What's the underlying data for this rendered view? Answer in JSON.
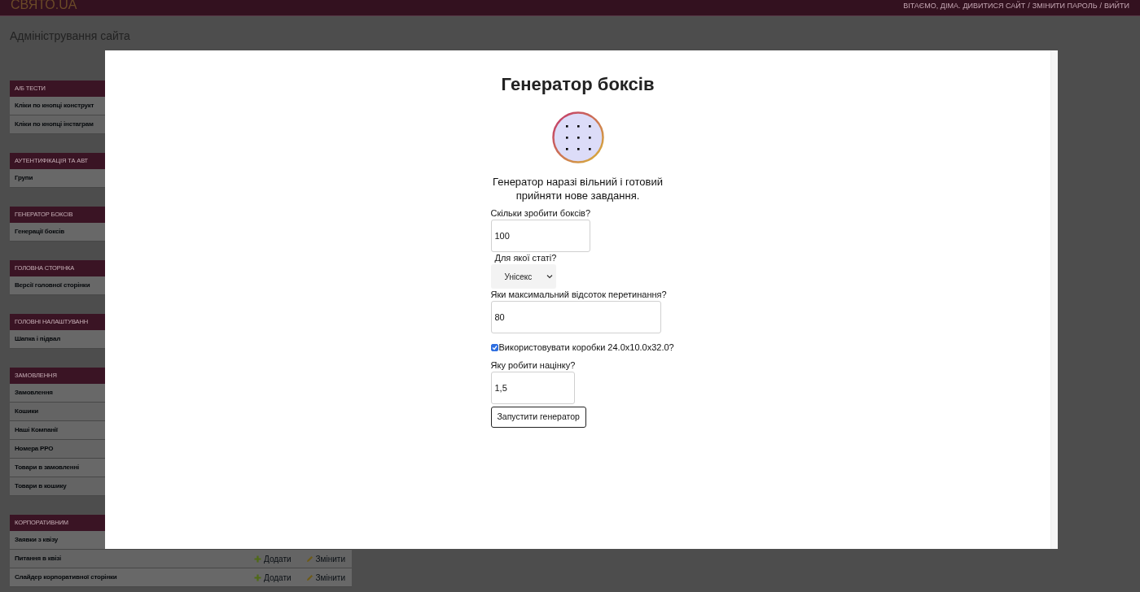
{
  "header": {
    "logo": "СВЯТО.UA",
    "greeting": "ВІТАЄМО, ДІМА.",
    "links": [
      "ДИВИТИСЯ САЙТ",
      "/",
      "ЗМІНИТИ ПАРОЛЬ",
      "/",
      "ВИЙТИ"
    ]
  },
  "page_title": "Адміністрування сайта",
  "sidebar": {
    "sections": [
      {
        "title": "А/Б ТЕСТИ",
        "items": [
          {
            "label": "Кліки по кнопці конструкт"
          },
          {
            "label": "Кліки по кнопці інстаграм"
          }
        ]
      },
      {
        "title": "АУТЕНТИФІКАЦІЯ ТА АВТ",
        "items": [
          {
            "label": "Групи"
          }
        ]
      },
      {
        "title": "ГЕНЕРАТОР БОКСІВ",
        "items": [
          {
            "label": "Генерації боксів"
          }
        ]
      },
      {
        "title": "ГОЛОВНА СТОРІНКА",
        "items": [
          {
            "label": "Версії головної сторінки"
          }
        ]
      },
      {
        "title": "ГОЛОВНІ НАЛАШТУВАНН",
        "items": [
          {
            "label": "Шапка і підвал"
          }
        ]
      },
      {
        "title": "ЗАМОВЛЕННЯ",
        "items": [
          {
            "label": "Замовлення"
          },
          {
            "label": "Кошики"
          },
          {
            "label": "Наші Компанії"
          },
          {
            "label": "Номера РРО"
          },
          {
            "label": "Товари в замовленні"
          },
          {
            "label": "Товари в кошику"
          }
        ]
      },
      {
        "title": "КОРПОРАТИВНИМ",
        "items": [
          {
            "label": "Заявки з квізу"
          },
          {
            "label": "Питання в квізі",
            "actions": [
              {
                "kind": "add",
                "label": "Додати"
              },
              {
                "kind": "edit",
                "label": "Змінити"
              }
            ]
          },
          {
            "label": "Слайдер корпоративної сторінки",
            "actions": [
              {
                "kind": "add",
                "label": "Додати"
              },
              {
                "kind": "edit",
                "label": "Змінити"
              }
            ]
          }
        ]
      }
    ]
  },
  "modal": {
    "title": "Генератор боксів",
    "status": "Генератор наразі вільний і готовий прийняти нове завдання.",
    "fields": [
      {
        "kind": "input",
        "label": "Скільки зробити боксів?",
        "value": "100"
      },
      {
        "kind": "select",
        "label": "Для якої статі?",
        "value": "Унісекс"
      },
      {
        "kind": "input",
        "label": "Яки максимальний відсоток перетинання?",
        "value": "80"
      },
      {
        "kind": "checkbox",
        "label": "Використовувати коробки 24.0x10.0x32.0?",
        "checked": true
      },
      {
        "kind": "input",
        "label": "Яку робити націнку?",
        "value": "1,5"
      }
    ],
    "button": "Запустити генератор"
  }
}
